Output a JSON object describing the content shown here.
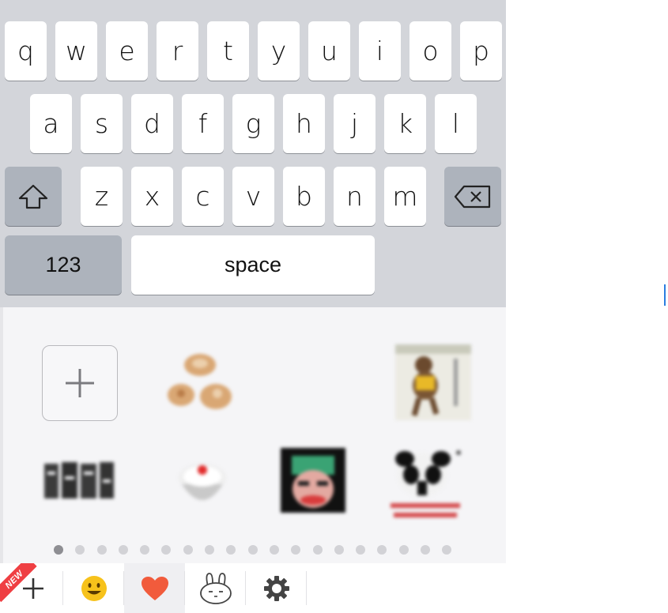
{
  "keyboard": {
    "row1": [
      "q",
      "w",
      "e",
      "r",
      "t",
      "y",
      "u",
      "i",
      "o",
      "p"
    ],
    "row2": [
      "a",
      "s",
      "d",
      "f",
      "g",
      "h",
      "j",
      "k",
      "l"
    ],
    "row3": [
      "z",
      "x",
      "c",
      "v",
      "b",
      "n",
      "m"
    ],
    "numbers_label": "123",
    "space_label": "space",
    "shift_icon": "shift-arrow-icon",
    "delete_icon": "backspace-icon"
  },
  "sticker_panel": {
    "add_icon": "plus-icon",
    "stickers": [
      "sticker-cookies",
      "sticker-bear-dancing",
      "sticker-chinese-text",
      "sticker-cupcake",
      "sticker-anime-face",
      "sticker-panda-meme"
    ],
    "page_count": 19,
    "active_page": 1
  },
  "toolbar": {
    "new_badge": "NEW",
    "tabs": [
      "plus-icon",
      "smiley-icon",
      "heart-icon",
      "bunny-icon",
      "gear-icon"
    ],
    "active_tab": "heart-icon"
  },
  "colors": {
    "accent": "#ef3f43",
    "heart": "#f15b3c",
    "smiley": "#f7c21b",
    "cursor": "#2a7de0"
  }
}
